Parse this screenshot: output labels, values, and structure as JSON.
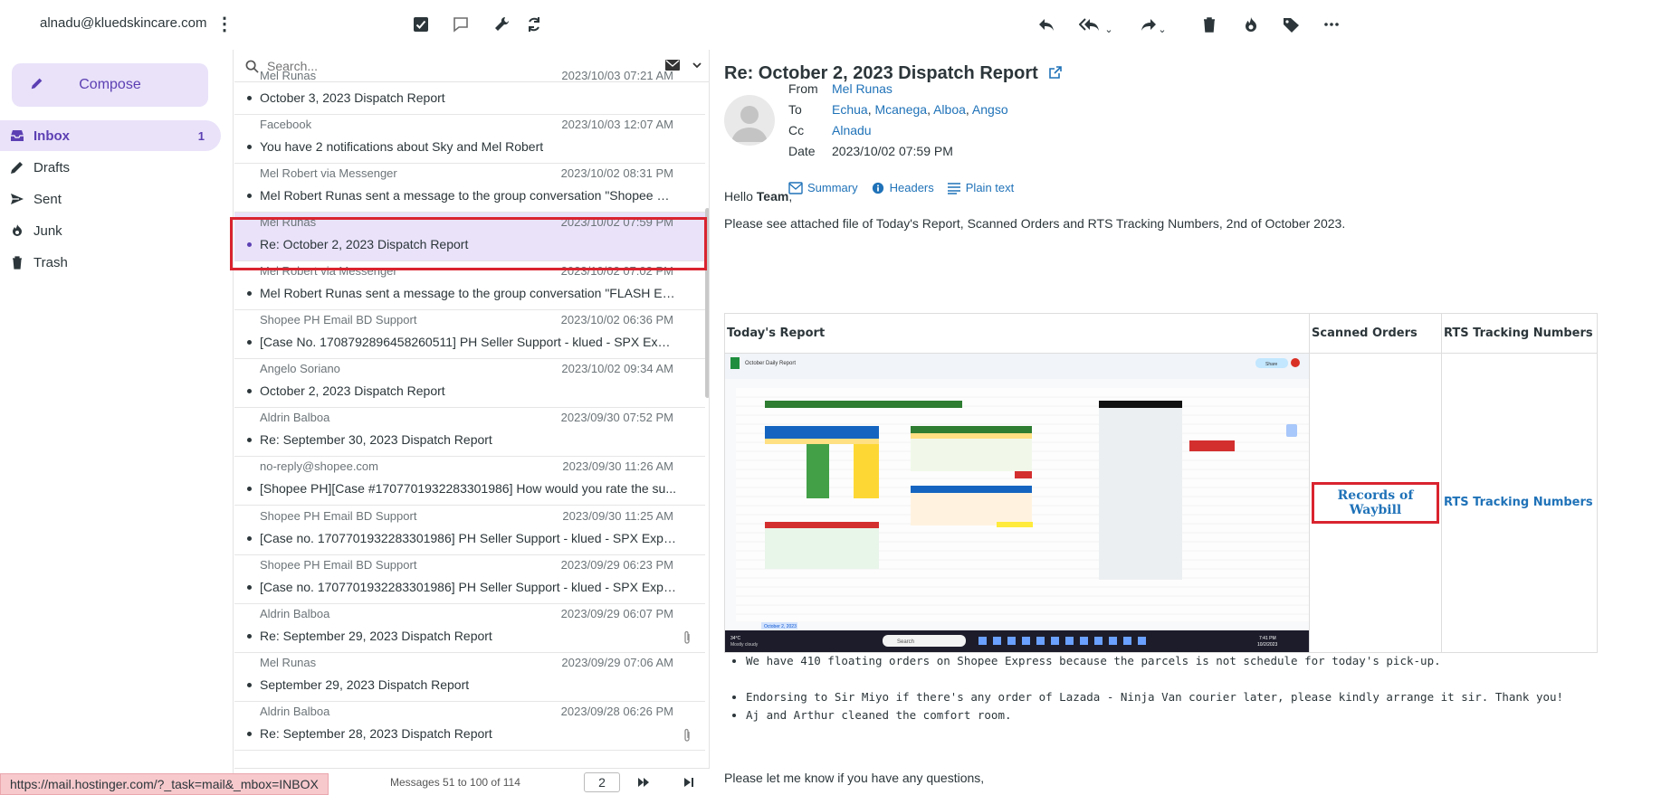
{
  "account": {
    "email": "alnadu@kluedskincare.com"
  },
  "toolbar": {
    "icons": [
      "checkbox-icon",
      "chat-icon",
      "wrench-icon",
      "sync-icon",
      "reply-icon",
      "reply-all-icon",
      "forward-icon",
      "delete-icon",
      "junk-icon",
      "tag-icon",
      "more-icon"
    ]
  },
  "nav": {
    "compose_label": "Compose",
    "items": [
      {
        "label": "Inbox",
        "count": "1"
      },
      {
        "label": "Drafts"
      },
      {
        "label": "Sent"
      },
      {
        "label": "Junk"
      },
      {
        "label": "Trash"
      }
    ]
  },
  "search": {
    "placeholder": "Search..."
  },
  "messages": [
    {
      "from": "Mel Runas",
      "date": "2023/10/03 07:21 AM",
      "subject": "October 3, 2023 Dispatch Report"
    },
    {
      "from": "Facebook",
      "date": "2023/10/03 12:07 AM",
      "subject": "You have 2 notifications about Sky and Mel Robert"
    },
    {
      "from": "Mel Robert via Messenger",
      "date": "2023/10/02 08:31 PM",
      "subject": "Mel Robert Runas sent a message to the group conversation \"Shopee Ex..."
    },
    {
      "from": "Mel Runas",
      "date": "2023/10/02 07:59 PM",
      "subject": "Re: October 2, 2023 Dispatch Report",
      "selected": true
    },
    {
      "from": "Mel Robert via Messenger",
      "date": "2023/10/02 07:02 PM",
      "subject": "Mel Robert Runas sent a message to the group conversation \"FLASH EX..."
    },
    {
      "from": "Shopee PH Email BD Support",
      "date": "2023/10/02 06:36 PM",
      "subject": "[Case No. 1708792896458260511] PH Seller Support - klued - SPX Expr..."
    },
    {
      "from": "Angelo Soriano",
      "date": "2023/10/02 09:34 AM",
      "subject": "October 2, 2023 Dispatch Report"
    },
    {
      "from": "Aldrin Balboa",
      "date": "2023/09/30 07:52 PM",
      "subject": "Re: September 30, 2023 Dispatch Report"
    },
    {
      "from": "no-reply@shopee.com",
      "date": "2023/09/30 11:26 AM",
      "subject": "[Shopee PH][Case #1707701932283301986] How would you rate the su..."
    },
    {
      "from": "Shopee PH Email BD Support",
      "date": "2023/09/30 11:25 AM",
      "subject": "[Case no. 1707701932283301986] PH Seller Support - klued - SPX Expre..."
    },
    {
      "from": "Shopee PH Email BD Support",
      "date": "2023/09/29 06:23 PM",
      "subject": "[Case no. 1707701932283301986] PH Seller Support - klued - SPX Expre..."
    },
    {
      "from": "Aldrin Balboa",
      "date": "2023/09/29 06:07 PM",
      "subject": "Re: September 29, 2023 Dispatch Report",
      "attachment": true
    },
    {
      "from": "Mel Runas",
      "date": "2023/09/29 07:06 AM",
      "subject": "September 29, 2023 Dispatch Report"
    },
    {
      "from": "Aldrin Balboa",
      "date": "2023/09/28 06:26 PM",
      "subject": "Re: September 28, 2023 Dispatch Report",
      "attachment": true
    }
  ],
  "list_footer": {
    "info": "Messages 51 to 100 of 114",
    "page": "2"
  },
  "status_url": "https://mail.hostinger.com/?_task=mail&_mbox=INBOX",
  "message": {
    "subject": "Re: October 2, 2023 Dispatch Report",
    "labels": {
      "from": "From",
      "to": "To",
      "cc": "Cc",
      "date": "Date"
    },
    "from": "Mel Runas",
    "to": [
      "Echua",
      "Mcanega",
      "Alboa",
      "Angso"
    ],
    "cc": "Alnadu",
    "date": "2023/10/02 07:59 PM",
    "links": {
      "summary": "Summary",
      "headers": "Headers",
      "plain": "Plain text"
    },
    "greeting_prefix": "Hello ",
    "greeting_name": "Team",
    "greeting_suffix": ",",
    "intro": "Please see attached file of Today's Report, Scanned Orders and RTS Tracking Numbers, 2nd of October 2023.",
    "table": {
      "col1": "Today's Report",
      "col2": "Scanned Orders",
      "col3": "RTS Tracking Numbers",
      "waybill_link": "Records of Waybill",
      "rts_link": "RTS Tracking Numbers"
    },
    "sheet": {
      "doc_title": "October Daily Report",
      "share": "Share",
      "tab": "October 2, 2023",
      "search": "Search",
      "weather_temp": "34°C",
      "weather_desc": "Mostly cloudy",
      "time": "7:41 PM",
      "date": "10/2/2023"
    },
    "bullets": [
      "We have 410 floating orders on Shopee Express because the parcels is not schedule for today's pick-up.",
      "Endorsing to Sir Miyo if there's any order of Lazada - Ninja Van courier later, please kindly arrange it sir. Thank you!",
      "Aj and Arthur cleaned the comfort room."
    ],
    "closing": "Please let me know if you have any questions,"
  }
}
